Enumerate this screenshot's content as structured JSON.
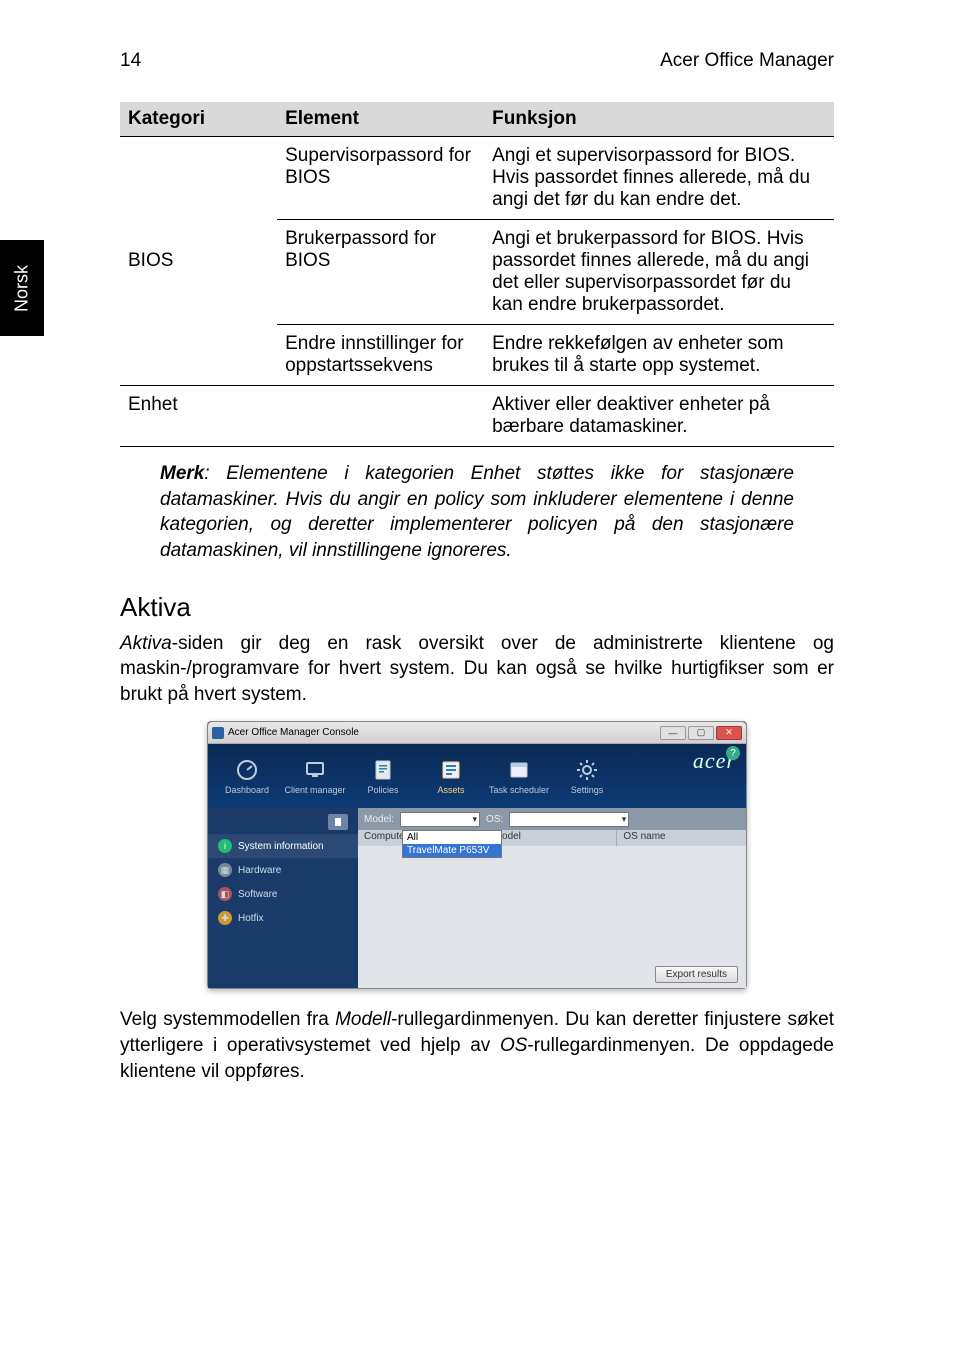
{
  "page_number": "14",
  "header_title": "Acer Office Manager",
  "side_tab": "Norsk",
  "table": {
    "headers": {
      "cat": "Kategori",
      "elem": "Element",
      "func": "Funksjon"
    },
    "rows": [
      {
        "cat": "BIOS",
        "elem": "Supervisorpassord for BIOS",
        "func": "Angi et supervisorpassord for BIOS. Hvis passordet finnes allerede, må du angi det før du kan endre det."
      },
      {
        "cat": "",
        "elem": "Brukerpassord for BIOS",
        "func": "Angi et brukerpassord for BIOS. Hvis passordet finnes allerede, må du angi det eller supervisorpassordet før du kan endre brukerpassordet."
      },
      {
        "cat": "",
        "elem": "Endre innstillinger for oppstartssekvens",
        "func": "Endre rekkefølgen av enheter som brukes til å starte opp systemet."
      },
      {
        "cat": "Enhet",
        "elem": "",
        "func": "Aktiver eller deaktiver enheter på bærbare datamaskiner."
      }
    ]
  },
  "note": {
    "bold": "Merk",
    "rest": ": Elementene i kategorien Enhet støttes ikke for stasjonære datamaskiner. Hvis du angir en policy som inkluderer elementene i denne kategorien, og deretter implementerer policyen på den stasjonære datamaskinen, vil innstillingene ignoreres."
  },
  "section_title": "Aktiva",
  "para1": {
    "ital": "Aktiva",
    "rest": "-siden gir deg en rask oversikt over de administrerte klientene og maskin-/programvare for hvert system. Du kan også se hvilke hurtigfikser som er brukt på hvert system."
  },
  "console": {
    "title": "Acer Office Manager Console",
    "brand": "acer",
    "help": "?",
    "nav": [
      {
        "key": "dashboard",
        "label": "Dashboard"
      },
      {
        "key": "client-manager",
        "label": "Client manager"
      },
      {
        "key": "policies",
        "label": "Policies"
      },
      {
        "key": "assets",
        "label": "Assets"
      },
      {
        "key": "task-scheduler",
        "label": "Task scheduler"
      },
      {
        "key": "settings",
        "label": "Settings"
      }
    ],
    "sidepanel": [
      {
        "key": "system-information",
        "label": "System information"
      },
      {
        "key": "hardware",
        "label": "Hardware"
      },
      {
        "key": "software",
        "label": "Software"
      },
      {
        "key": "hotfix",
        "label": "Hotfix"
      }
    ],
    "filter": {
      "model_label": "Model:",
      "os_label": "OS:",
      "dd_open_all": "All",
      "dd_open_item": "TravelMate P653V"
    },
    "columns": {
      "c1": "Computer na",
      "c2": "Model",
      "c3": "OS name"
    },
    "export_btn": "Export results"
  },
  "para2": {
    "pre": "Velg systemmodellen fra ",
    "it1": "Modell",
    "mid": "-rullegardinmenyen. Du kan deretter finjustere søket ytterligere i operativsystemet ved hjelp av ",
    "it2": "OS",
    "post": "-rullegardinmenyen. De oppdagede klientene vil oppføres."
  }
}
